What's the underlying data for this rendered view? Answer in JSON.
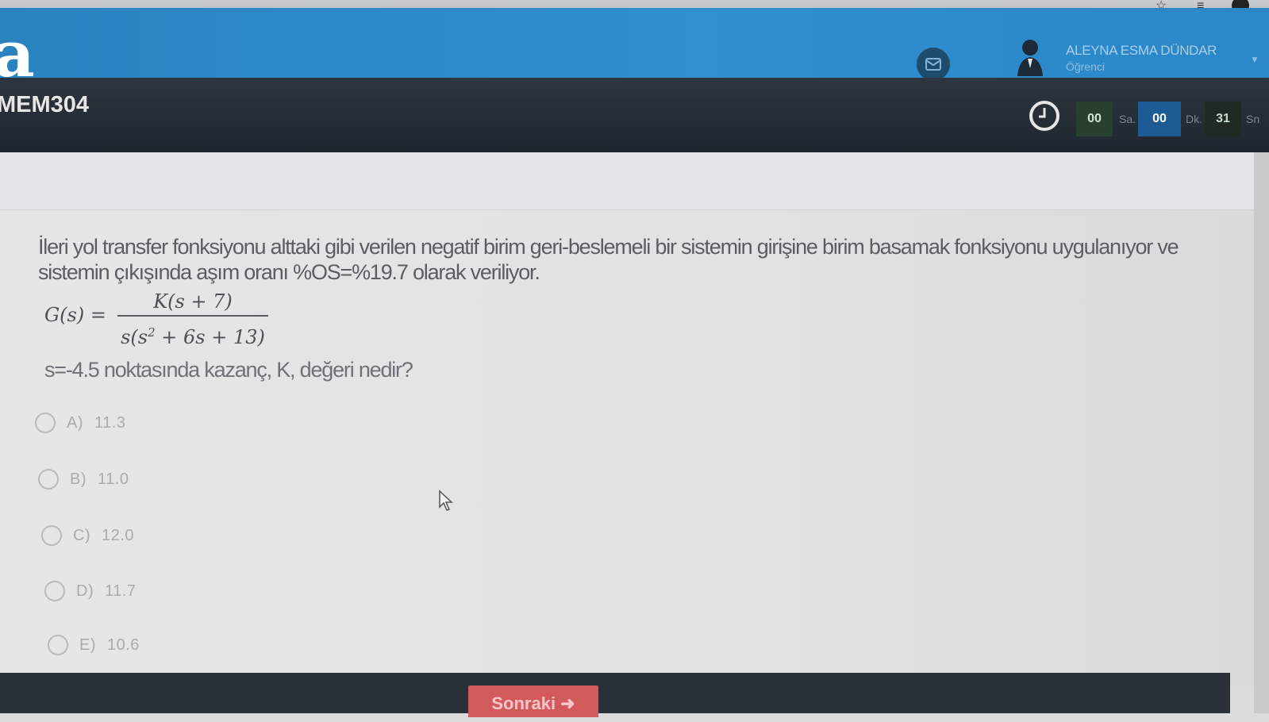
{
  "header": {
    "brand_letter": "a",
    "user": {
      "name": "ALEYNA ESMA DÜNDAR",
      "role": "Öğrenci"
    }
  },
  "course": {
    "code": "MEM304",
    "timer": {
      "hours": "00",
      "hours_unit": "Sa.",
      "minutes": "00",
      "minutes_unit": "Dk.",
      "seconds": "31",
      "seconds_unit": "Sn"
    }
  },
  "question": {
    "text": "İleri yol transfer fonksiyonu alttaki gibi verilen negatif birim geri-beslemeli bir sistemin girişine birim basamak fonksiyonu uygulanıyor ve sistemin çıkışında aşım oranı %OS=%19.7 olarak veriliyor.",
    "formula": {
      "lhs": "G(s) =",
      "numerator": "K(s + 7)",
      "denominator_pre": "s(s",
      "denominator_exp": "2",
      "denominator_post": " + 6s + 13)"
    },
    "sub_question": "s=-4.5 noktasında kazanç, K, değeri nedir?",
    "options": [
      {
        "letter": "A)",
        "value": "11.3"
      },
      {
        "letter": "B)",
        "value": "11.0"
      },
      {
        "letter": "C)",
        "value": "12.0"
      },
      {
        "letter": "D)",
        "value": "11.7"
      },
      {
        "letter": "E)",
        "value": "10.6"
      }
    ]
  },
  "footer": {
    "next_label": "Sonraki ➜"
  },
  "colors": {
    "header_blue": "#2f8fcf",
    "course_bar": "#1f262e",
    "next_button": "#d25a5d",
    "timer_minutes": "#1d5b95"
  }
}
